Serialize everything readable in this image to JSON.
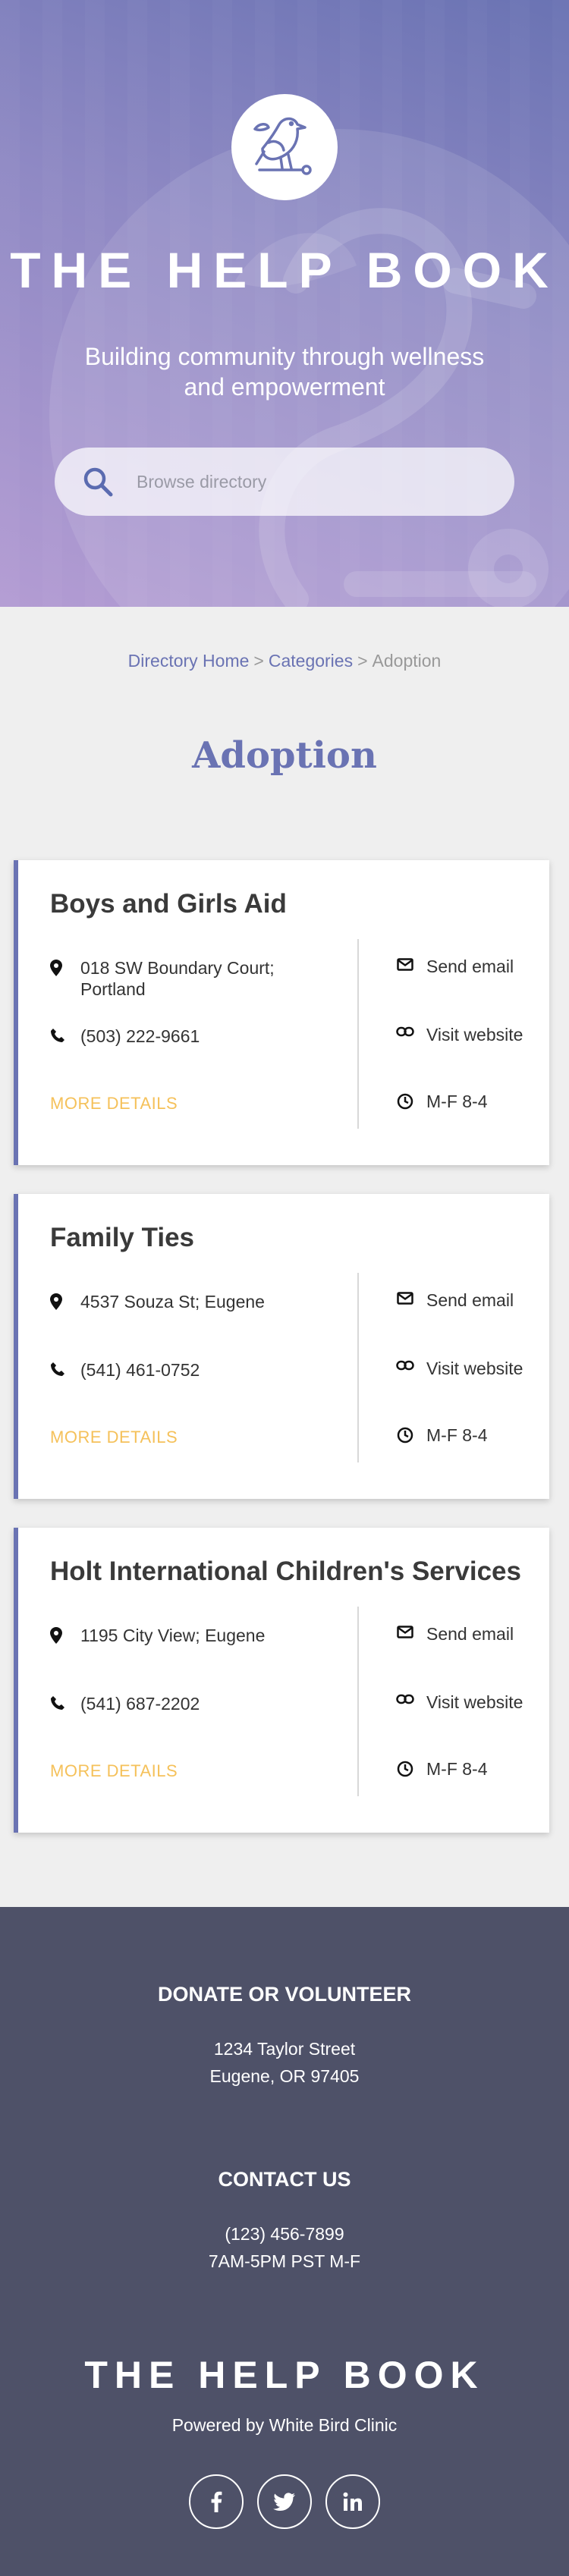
{
  "hero": {
    "title": "THE HELP BOOK",
    "subtitle": "Building community through wellness and empowerment",
    "search_placeholder": "Browse directory",
    "bg_gradient": [
      "#6a73b3",
      "#b39cd3"
    ]
  },
  "breadcrumb": {
    "home": "Directory Home",
    "sep": ">",
    "categories": "Categories",
    "current": "Adoption"
  },
  "page_title": "Adoption",
  "cards": [
    {
      "name": "Boys and Girls Aid",
      "address": "018 SW Boundary Court; Portland",
      "phone": "(503) 222-9661",
      "more": "MORE DETAILS",
      "email": "Send email",
      "website": "Visit website",
      "hours": "M-F 8-4"
    },
    {
      "name": "Family Ties",
      "address": "4537 Souza St; Eugene",
      "phone": "(541) 461-0752",
      "more": "MORE DETAILS",
      "email": "Send email",
      "website": "Visit website",
      "hours": "M-F 8-4"
    },
    {
      "name": "Holt International Children's Services",
      "address": "1195 City View; Eugene",
      "phone": "(541) 687-2202",
      "more": "MORE DETAILS",
      "email": "Send email",
      "website": "Visit website",
      "hours": "M-F 8-4"
    }
  ],
  "footer": {
    "donate_heading": "DONATE OR VOLUNTEER",
    "address_line1": "1234 Taylor Street",
    "address_line2": "Eugene, OR 97405",
    "contact_heading": "CONTACT US",
    "contact_phone": "(123) 456-7899",
    "contact_hours": "7AM-5PM PST M-F",
    "title": "THE HELP BOOK",
    "powered_by": "Powered by White Bird Clinic",
    "social_icons": [
      "facebook-icon",
      "twitter-icon",
      "linkedin-icon"
    ]
  },
  "colors": {
    "accent": "#6a73b3",
    "more_link": "#f5c15a",
    "footer_bg": "#4e5168",
    "page_bg": "#efefef"
  }
}
